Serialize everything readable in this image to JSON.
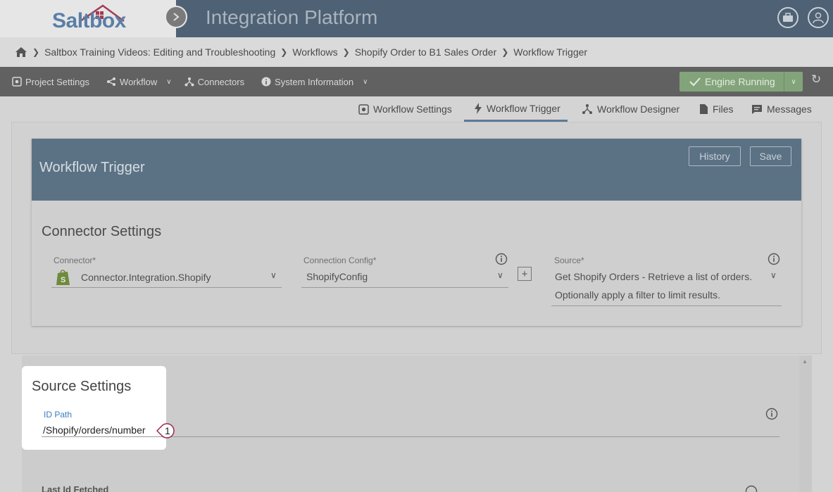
{
  "brand": {
    "logo_text": "Saltbox",
    "app_title": "Integration Platform"
  },
  "breadcrumb": {
    "items": [
      "Saltbox Training Videos: Editing and Troubleshooting",
      "Workflows",
      "Shopify Order to B1 Sales Order",
      "Workflow Trigger"
    ]
  },
  "navbar": {
    "project_settings": "Project Settings",
    "workflow": "Workflow",
    "connectors": "Connectors",
    "system_information": "System Information",
    "engine_status": "Engine Running"
  },
  "tabs": [
    {
      "label": "Workflow Settings",
      "icon": "gear-icon"
    },
    {
      "label": "Workflow Trigger",
      "icon": "lightning-icon",
      "active": true
    },
    {
      "label": "Workflow Designer",
      "icon": "hierarchy-icon"
    },
    {
      "label": "Files",
      "icon": "file-icon"
    },
    {
      "label": "Messages",
      "icon": "message-icon"
    }
  ],
  "card": {
    "title": "Workflow Trigger",
    "history_label": "History",
    "save_label": "Save"
  },
  "connector_settings": {
    "title": "Connector Settings",
    "connector_label": "Connector*",
    "connector_value": "Connector.Integration.Shopify",
    "config_label": "Connection Config*",
    "config_value": "ShopifyConfig",
    "source_label": "Source*",
    "source_value_line1": "Get Shopify Orders - Retrieve a list of orders.",
    "source_value_line2": "Optionally apply a filter to limit results."
  },
  "source_settings": {
    "title": "Source Settings",
    "id_path_label": "ID Path",
    "id_path_value": "/Shopify/orders/number",
    "callout_number": "1",
    "last_id_label": "Last Id Fetched"
  },
  "colors": {
    "topbar": "#4f6174",
    "navbar": "#616161",
    "engine_green": "#83a47b",
    "card_header": "#5b7284",
    "highlight": "#ffffff",
    "callout_border": "#9b2c4a"
  }
}
